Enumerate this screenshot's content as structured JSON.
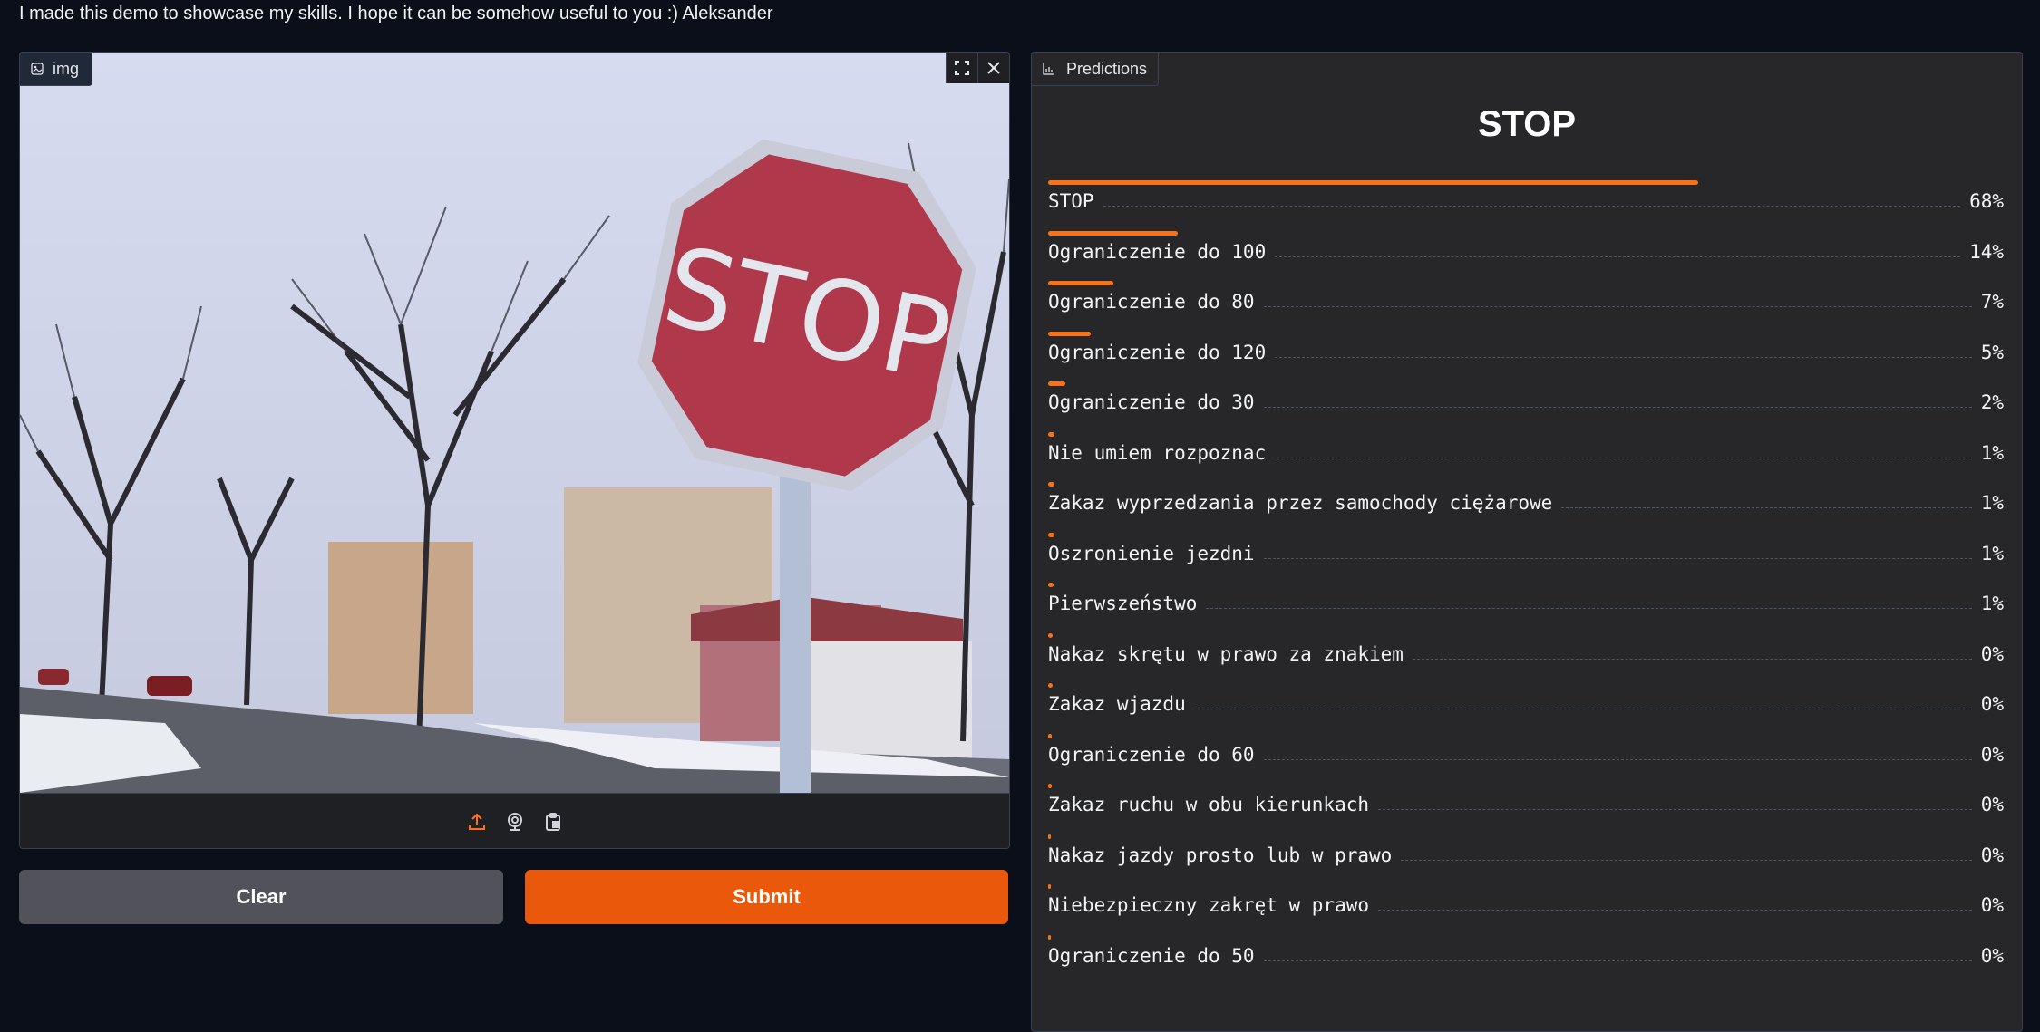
{
  "intro_text": "I made this demo to showcase my skills. I hope it can be somehow useful to you :) Aleksander",
  "image_input": {
    "label": "img",
    "actions": [
      "fullscreen-icon",
      "close-icon"
    ],
    "source_icons": [
      "upload-icon",
      "webcam-icon",
      "clipboard-icon"
    ],
    "photo_sign_text": "STOP"
  },
  "buttons": {
    "clear": "Clear",
    "submit": "Submit"
  },
  "predictions": {
    "tab_label": "Predictions",
    "top_label": "STOP",
    "items": [
      {
        "label": "STOP",
        "value": "68%",
        "fraction": 0.68
      },
      {
        "label": "Ograniczenie do 100",
        "value": "14%",
        "fraction": 0.136
      },
      {
        "label": "Ograniczenie do 80",
        "value": "7%",
        "fraction": 0.068
      },
      {
        "label": "Ograniczenie do 120",
        "value": "5%",
        "fraction": 0.045
      },
      {
        "label": "Ograniczenie do 30",
        "value": "2%",
        "fraction": 0.018
      },
      {
        "label": "Nie umiem rozpoznac",
        "value": "1%",
        "fraction": 0.007
      },
      {
        "label": "Zakaz wyprzedzania przez samochody ciężarowe",
        "value": "1%",
        "fraction": 0.007
      },
      {
        "label": "Oszronienie jezdni",
        "value": "1%",
        "fraction": 0.007
      },
      {
        "label": "Pierwszeństwo",
        "value": "1%",
        "fraction": 0.006
      },
      {
        "label": "Nakaz skrętu w prawo za znakiem",
        "value": "0%",
        "fraction": 0.005
      },
      {
        "label": "Zakaz wjazdu",
        "value": "0%",
        "fraction": 0.005
      },
      {
        "label": "Ograniczenie do 60",
        "value": "0%",
        "fraction": 0.004
      },
      {
        "label": "Zakaz ruchu w obu kierunkach",
        "value": "0%",
        "fraction": 0.004
      },
      {
        "label": "Nakaz jazdy prosto lub w prawo",
        "value": "0%",
        "fraction": 0.003
      },
      {
        "label": "Niebezpieczny zakręt w prawo",
        "value": "0%",
        "fraction": 0.003
      },
      {
        "label": "Ograniczenie do 50",
        "value": "0%",
        "fraction": 0.003
      }
    ]
  },
  "colors": {
    "accent": "#ea580c",
    "bar": "#f97316",
    "background": "#0b0f19"
  }
}
